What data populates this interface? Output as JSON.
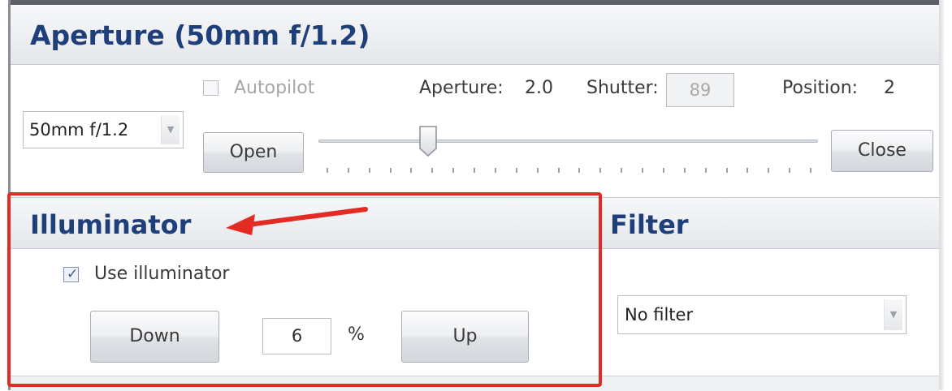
{
  "aperture": {
    "title": "Aperture (50mm f/1.2)",
    "autopilot_label": "Autopilot",
    "autopilot_checked": false,
    "aperture_label": "Aperture:",
    "aperture_value": "2.0",
    "shutter_label": "Shutter:",
    "shutter_value": "89",
    "position_label": "Position:",
    "position_value": "2",
    "lens_select": "50mm f/1.2",
    "open_label": "Open",
    "close_label": "Close",
    "slider_fraction": 0.21
  },
  "illuminator": {
    "title": "Illuminator",
    "use_label": "Use illuminator",
    "use_checked": true,
    "down_label": "Down",
    "percent_value": "6",
    "percent_unit": "%",
    "up_label": "Up"
  },
  "filter": {
    "title": "Filter",
    "selected": "No filter"
  },
  "colors": {
    "header_text": "#1f3f7a",
    "annotation_red": "#e32b24"
  },
  "icons": {
    "dropdown": "chevron-down-icon",
    "check": "checkmark-icon",
    "annotation": "arrow-icon"
  }
}
